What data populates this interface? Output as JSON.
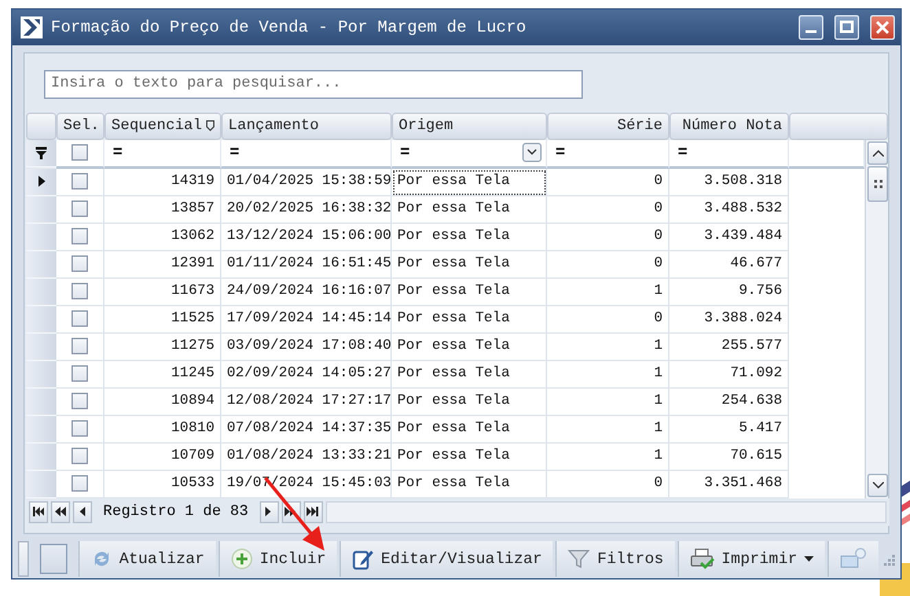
{
  "window": {
    "title": "Formação do Preço de Venda - Por Margem de Lucro"
  },
  "search": {
    "placeholder": "Insira o texto para pesquisar..."
  },
  "columns": [
    {
      "label": "Sel.",
      "kind": "check",
      "checked": false
    },
    {
      "label": "Sequencial",
      "kind": "num",
      "filter": "=",
      "sorted": true
    },
    {
      "label": "Lançamento",
      "kind": "text",
      "filter": "="
    },
    {
      "label": "Origem",
      "kind": "combo",
      "filter": "="
    },
    {
      "label": "Série",
      "kind": "num",
      "filter": "="
    },
    {
      "label": "Número Nota",
      "kind": "num",
      "filter": "="
    }
  ],
  "rows": [
    {
      "selected": true,
      "checked": false,
      "cells": [
        "14319",
        "01/04/2025 15:38:59",
        "Por essa Tela",
        "0",
        "3.508.318"
      ]
    },
    {
      "selected": false,
      "checked": false,
      "cells": [
        "13857",
        "20/02/2025 16:38:32",
        "Por essa Tela",
        "0",
        "3.488.532"
      ]
    },
    {
      "selected": false,
      "checked": false,
      "cells": [
        "13062",
        "13/12/2024 15:06:00",
        "Por essa Tela",
        "0",
        "3.439.484"
      ]
    },
    {
      "selected": false,
      "checked": false,
      "cells": [
        "12391",
        "01/11/2024 16:51:45",
        "Por essa Tela",
        "0",
        "46.677"
      ]
    },
    {
      "selected": false,
      "checked": false,
      "cells": [
        "11673",
        "24/09/2024 16:16:07",
        "Por essa Tela",
        "1",
        "9.756"
      ]
    },
    {
      "selected": false,
      "checked": false,
      "cells": [
        "11525",
        "17/09/2024 14:45:14",
        "Por essa Tela",
        "0",
        "3.388.024"
      ]
    },
    {
      "selected": false,
      "checked": false,
      "cells": [
        "11275",
        "03/09/2024 17:08:40",
        "Por essa Tela",
        "1",
        "255.577"
      ]
    },
    {
      "selected": false,
      "checked": false,
      "cells": [
        "11245",
        "02/09/2024 14:05:27",
        "Por essa Tela",
        "1",
        "71.092"
      ]
    },
    {
      "selected": false,
      "checked": false,
      "cells": [
        "10894",
        "12/08/2024 17:27:17",
        "Por essa Tela",
        "1",
        "254.638"
      ]
    },
    {
      "selected": false,
      "checked": false,
      "cells": [
        "10810",
        "07/08/2024 14:37:35",
        "Por essa Tela",
        "1",
        "5.417"
      ]
    },
    {
      "selected": false,
      "checked": false,
      "cells": [
        "10709",
        "01/08/2024 13:33:21",
        "Por essa Tela",
        "1",
        "70.615"
      ]
    },
    {
      "selected": false,
      "checked": false,
      "cells": [
        "10533",
        "19/07/2024 15:45:03",
        "Por essa Tela",
        "0",
        "3.351.468"
      ]
    }
  ],
  "navigator": {
    "text": "Registro 1 de 83"
  },
  "toolbar": [
    {
      "kind": "refresh",
      "label": "Atualizar"
    },
    {
      "kind": "add",
      "label": "Incluir"
    },
    {
      "kind": "edit",
      "label": "Editar/Visualizar"
    },
    {
      "kind": "filter",
      "label": "Filtros"
    },
    {
      "kind": "print",
      "label": "Imprimir",
      "dropdown": true
    }
  ]
}
